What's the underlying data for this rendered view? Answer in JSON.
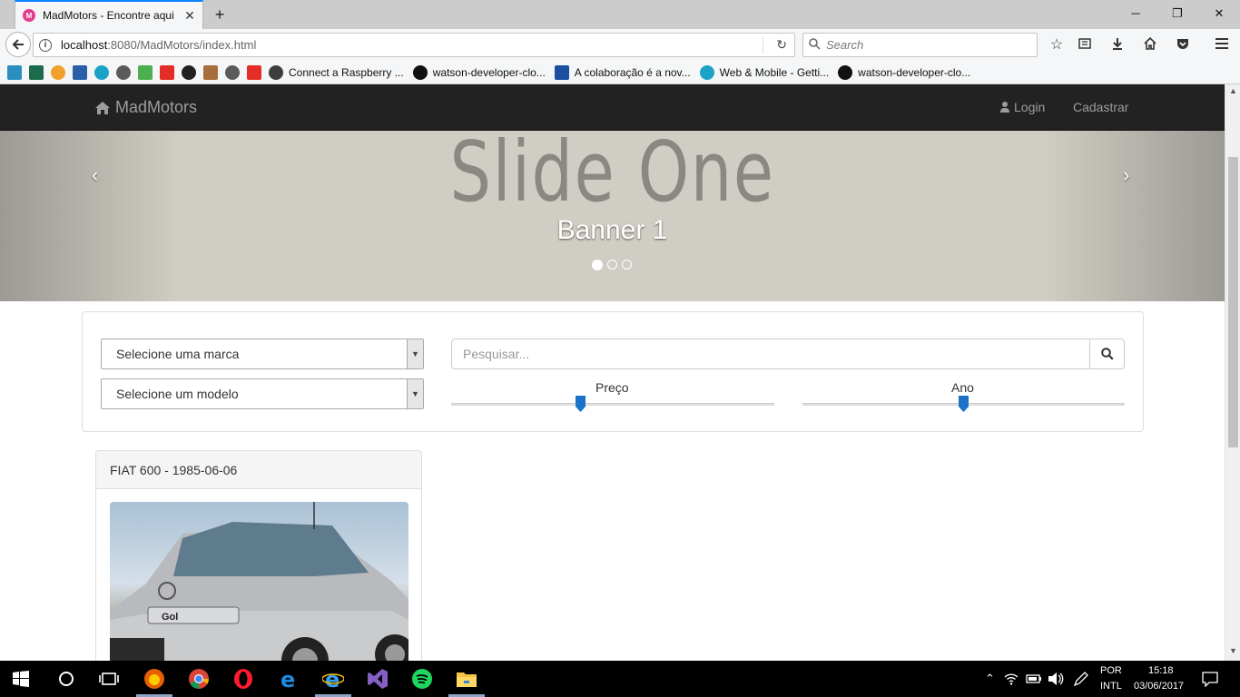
{
  "browser": {
    "tab_title": "MadMotors - Encontre aqui",
    "tab_favicon_text": "M",
    "url_host": "localhost",
    "url_rest": ":8080/MadMotors/index.html",
    "search_placeholder": "Search",
    "bookmarks": [
      {
        "label": "Connect a Raspberry ...",
        "icon": "raspberry-icon",
        "color": "#3d3d3d"
      },
      {
        "label": "watson-developer-clo...",
        "icon": "github-icon",
        "color": "#111111"
      },
      {
        "label": "A colaboração é a nov...",
        "icon": "link-icon",
        "color": "#1b4fa0"
      },
      {
        "label": "Web & Mobile - Getti...",
        "icon": "web-icon",
        "color": "#1aa3c7"
      },
      {
        "label": "watson-developer-clo...",
        "icon": "github-icon",
        "color": "#111111"
      }
    ]
  },
  "site": {
    "brand": "MadMotors",
    "nav": {
      "login": "Login",
      "register": "Cadastrar"
    },
    "carousel": {
      "slide_title": "Slide One",
      "caption": "Banner 1",
      "prev_arrow": "‹",
      "next_arrow": "›",
      "indicator_count": 3,
      "active_index": 0
    },
    "filters": {
      "brand_select": "Selecione uma marca",
      "model_select": "Selecione um modelo",
      "search_placeholder": "Pesquisar...",
      "price_label": "Preço",
      "price_level": 0.4,
      "year_label": "Ano",
      "year_level": 0.5
    },
    "listing": {
      "title": "FIAT 600 - 1985-06-06",
      "plate_text": "Gol"
    }
  },
  "taskbar": {
    "lang_top": "POR",
    "lang_bottom": "INTL",
    "time": "15:18",
    "date": "03/06/2017"
  },
  "colors": {
    "accent": "#0a84ff",
    "navbar": "#222222",
    "slider_thumb": "#1a73c8"
  }
}
